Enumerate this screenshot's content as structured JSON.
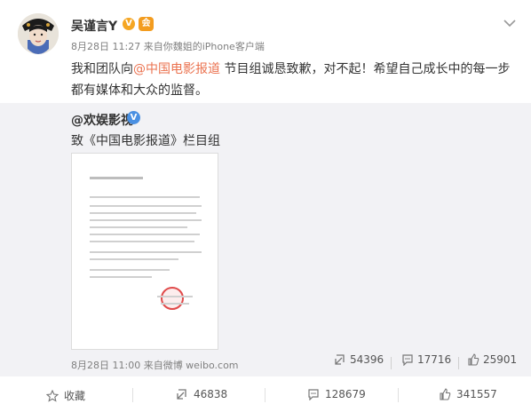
{
  "post": {
    "author": "吴谨言Y",
    "verify_badge": "V",
    "member_badge": "会",
    "time": "8月28日 11:27",
    "source": " 来自你魏姐的iPhone客户端",
    "text_before": "我和团队向",
    "mention": "@中国电影报道",
    "text_after": " 节目组诚恳致歉，对不起！希望自己成长中的每一步都有媒体和大众的监督。"
  },
  "retweet": {
    "author": "@欢娱影视",
    "verify_badge": "V",
    "text": "致《中国电影报道》栏目组",
    "time": "8月28日 11:00 来自微博 weibo.com",
    "stats": {
      "repost": "54396",
      "comment": "17716",
      "like": "25901"
    }
  },
  "actions": {
    "favorite": "收藏",
    "repost": "46838",
    "comment": "128679",
    "like": "341557"
  },
  "colors": {
    "mention": "#eb7350",
    "retweet_bg": "#f2f2f5",
    "verify_gold": "#f5a623",
    "verify_blue": "#4a90e2"
  },
  "icons": [
    "avatar",
    "chevron-down-icon",
    "repost-icon",
    "comment-icon",
    "like-icon",
    "star-icon"
  ]
}
